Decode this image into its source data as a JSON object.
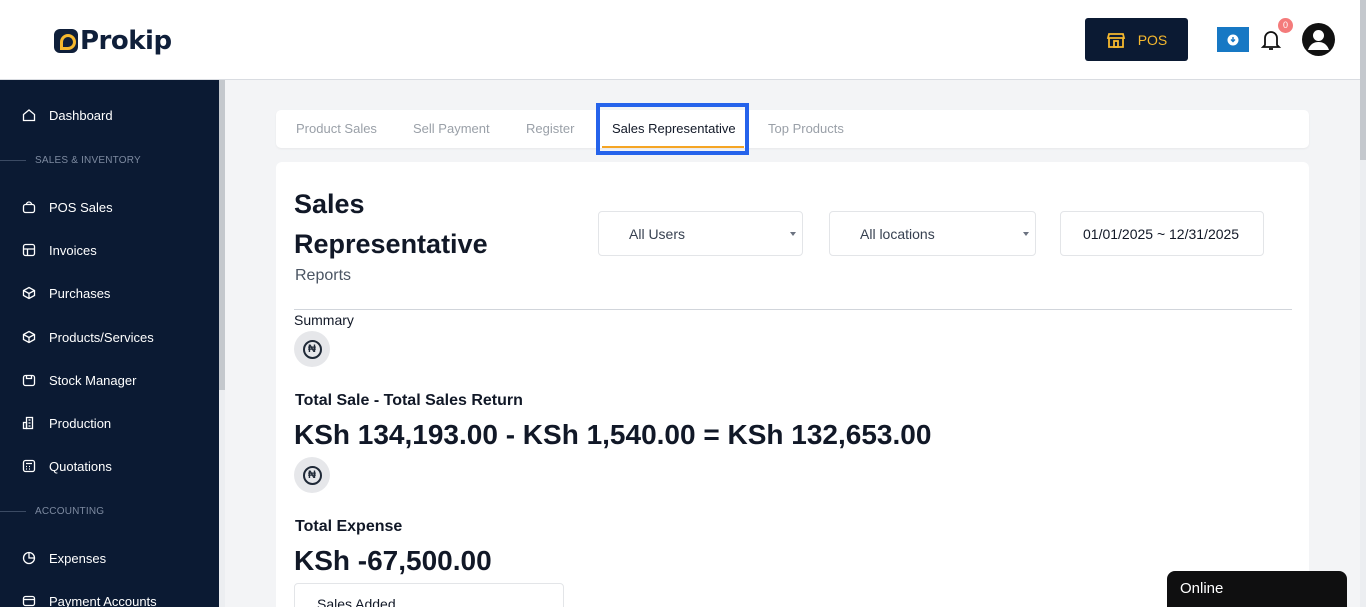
{
  "header": {
    "logo_text": "Prokip",
    "pos_label": "POS",
    "notification_count": "0"
  },
  "sidebar": {
    "items": [
      {
        "label": "Dashboard",
        "icon": "home-icon"
      },
      {
        "label": "POS Sales",
        "icon": "bag-icon"
      },
      {
        "label": "Invoices",
        "icon": "store-icon"
      },
      {
        "label": "Purchases",
        "icon": "box-icon"
      },
      {
        "label": "Products/Services",
        "icon": "cube-icon"
      },
      {
        "label": "Stock Manager",
        "icon": "folder-icon"
      },
      {
        "label": "Production",
        "icon": "building-icon"
      },
      {
        "label": "Quotations",
        "icon": "calculator-icon"
      },
      {
        "label": "Expenses",
        "icon": "pie-chart-icon"
      },
      {
        "label": "Payment Accounts",
        "icon": "wallet-icon"
      }
    ],
    "sections": [
      "SALES & INVENTORY",
      "ACCOUNTING"
    ]
  },
  "tabs": [
    {
      "label": "Product Sales",
      "active": false
    },
    {
      "label": "Sell Payment",
      "active": false
    },
    {
      "label": "Register",
      "active": false
    },
    {
      "label": "Sales Representative",
      "active": true
    },
    {
      "label": "Top Products",
      "active": false
    }
  ],
  "report": {
    "title": "Sales Representative",
    "subtitle": "Reports",
    "users_select": "All Users",
    "locations_select": "All locations",
    "date_range": "01/01/2025 ~ 12/31/2025",
    "summary_label": "Summary",
    "currency_symbol": "₦",
    "total_sale_label": "Total Sale - Total Sales Return",
    "total_sale_value": "KSh 134,193.00 - KSh 1,540.00 = KSh 132,653.00",
    "total_expense_label": "Total Expense",
    "total_expense_value": "KSh -67,500.00",
    "sales_added_label": "Sales Added"
  },
  "chat": {
    "status": "Online"
  },
  "colors": {
    "sidebar_bg": "#0b1a33",
    "accent": "#f5a524",
    "highlight": "#2563eb"
  }
}
